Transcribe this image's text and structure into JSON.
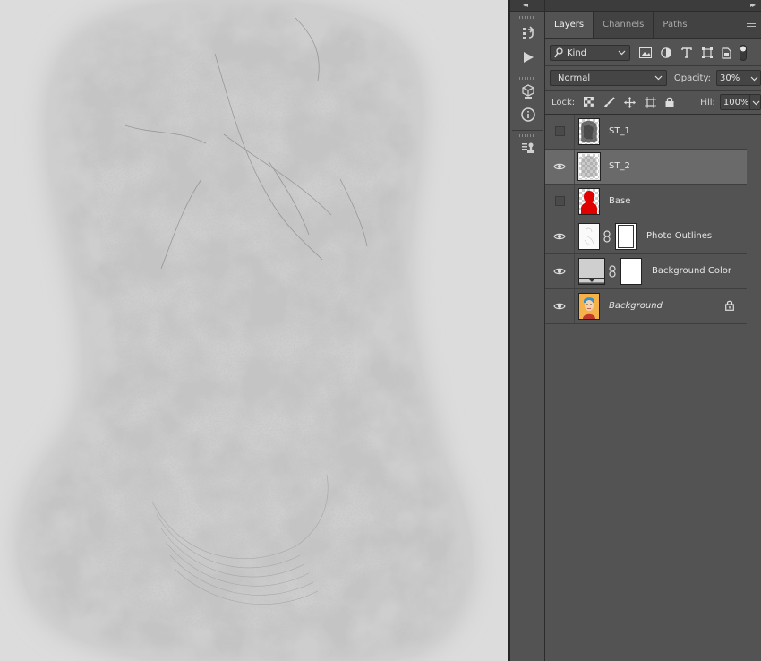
{
  "panel": {
    "tabs": [
      {
        "label": "Layers",
        "active": true
      },
      {
        "label": "Channels",
        "active": false
      },
      {
        "label": "Paths",
        "active": false
      }
    ],
    "filter": {
      "kind_label": "Kind"
    },
    "blend_mode": "Normal",
    "opacity_label": "Opacity:",
    "opacity_value": "30%",
    "lock_label": "Lock:",
    "fill_label": "Fill:",
    "fill_value": "100%"
  },
  "layers": [
    {
      "name": "ST_1",
      "visible": false,
      "selected": false
    },
    {
      "name": "ST_2",
      "visible": true,
      "selected": true
    },
    {
      "name": "Base",
      "visible": false,
      "selected": false
    },
    {
      "name": "Photo Outlines",
      "visible": true,
      "selected": false,
      "has_mask": true
    },
    {
      "name": "Background Color",
      "visible": true,
      "selected": false,
      "has_mask": true
    },
    {
      "name": "Background",
      "visible": true,
      "selected": false,
      "locked": true
    }
  ],
  "colors": {
    "panel_bg": "#535353",
    "selected_row": "#6a6a6a",
    "canvas_bg": "#dcdcdc",
    "base_thumb_red": "#e00000"
  }
}
